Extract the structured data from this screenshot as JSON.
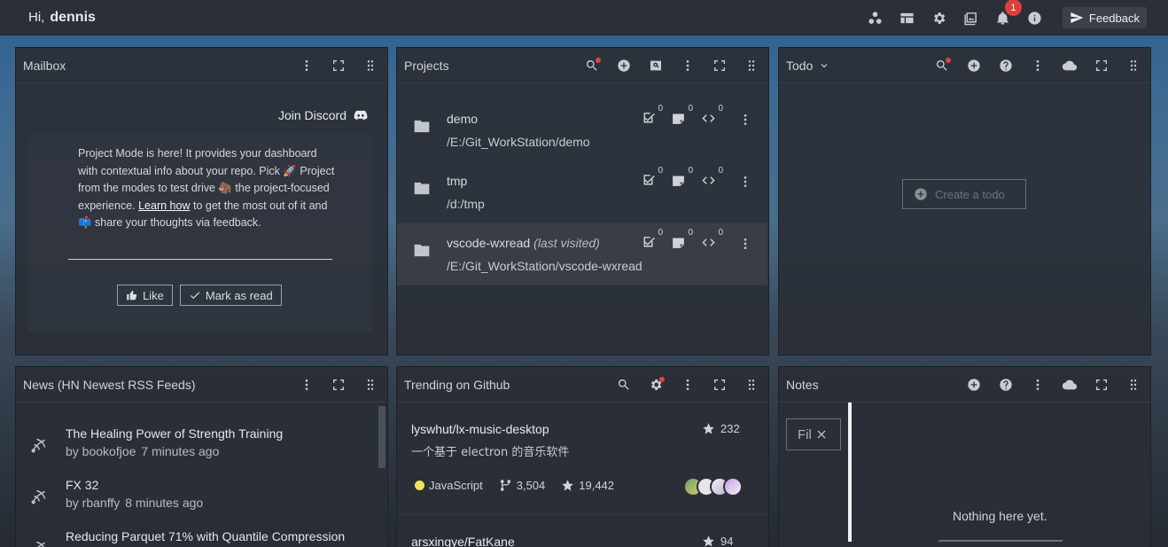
{
  "header": {
    "greeting": "Hi,",
    "username": "dennis",
    "notification_count": "1",
    "feedback_label": "Feedback",
    "icons": [
      "apps-icon",
      "layout-icon",
      "gear-icon",
      "image-icon",
      "bell-icon",
      "info-icon"
    ]
  },
  "mailbox": {
    "title": "Mailbox",
    "join_discord": "Join Discord",
    "message_html_parts": {
      "line1": "Project Mode is here! It provides your dashboard with contextual info about your repo. Pick 🚀 Project from the modes to test drive 🦣 the project-focused experience.",
      "learn_more": "Learn how",
      "line2": "to get the most out of it and 📫 share your thoughts via feedback."
    },
    "like_label": "Like",
    "mark_read_label": "Mark as read"
  },
  "projects": {
    "title": "Projects",
    "items": [
      {
        "name": "demo",
        "note": "",
        "path": "/E:/Git_WorkStation/demo",
        "todos": "0",
        "notes": "0",
        "snippets": "0"
      },
      {
        "name": "tmp",
        "note": "",
        "path": "/d:/tmp",
        "todos": "0",
        "notes": "0",
        "snippets": "0"
      },
      {
        "name": "vscode-wxread",
        "note": "(last visited)",
        "path": "/E:/Git_WorkStation/vscode-wxread",
        "todos": "0",
        "notes": "0",
        "snippets": "0"
      }
    ]
  },
  "todo": {
    "title": "Todo",
    "create_label": "Create a todo"
  },
  "news": {
    "title": "News (HN Newest RSS Feeds)",
    "items": [
      {
        "title": "The Healing Power of Strength Training",
        "by": "by bookofjoe",
        "time": "7 minutes ago"
      },
      {
        "title": "FX 32",
        "by": "by rbanffy",
        "time": "8 minutes ago"
      },
      {
        "title": "Reducing Parquet 71% with Quantile Compression",
        "by": "",
        "time": ""
      }
    ]
  },
  "trending": {
    "title": "Trending on Github",
    "repos": [
      {
        "name": "lyswhut/lx-music-desktop",
        "desc": "一个基于 electron 的音乐软件",
        "stars_today": "232",
        "language": "JavaScript",
        "forks": "3,504",
        "stars": "19,442",
        "lang_color": "#f1e05a"
      },
      {
        "name": "arsxingye/FatKane",
        "desc": "",
        "stars_today": "94",
        "language": "",
        "forks": "",
        "stars": "",
        "lang_color": "#f1e05a"
      }
    ]
  },
  "notes": {
    "title": "Notes",
    "filter_placeholder": "Fil",
    "empty_text": "Nothing here yet."
  }
}
